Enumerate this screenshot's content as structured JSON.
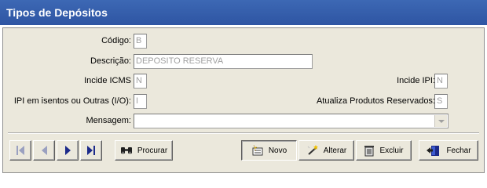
{
  "window": {
    "title": "Tipos de Depósitos"
  },
  "form": {
    "codigo": {
      "label": "Código:",
      "value": "B"
    },
    "descricao": {
      "label": "Descrição:",
      "value": "DEPOSITO RESERVA"
    },
    "incide_icms": {
      "label": "Incide ICMS",
      "value": "N"
    },
    "incide_ipi": {
      "label": "Incide IPI:",
      "value": "N"
    },
    "ipi_isentos": {
      "label": "IPI em isentos ou Outras (I/O):",
      "value": "I"
    },
    "atualiza": {
      "label": "Atualiza Produtos Reservados:",
      "value": "S"
    },
    "mensagem": {
      "label": "Mensagem:",
      "value": ""
    }
  },
  "toolbar": {
    "procurar": "Procurar",
    "novo": "Novo",
    "alterar": "Alterar",
    "excluir": "Excluir",
    "fechar": "Fechar"
  },
  "colors": {
    "title_bar": "#2e55a3",
    "panel": "#ebe8dc"
  },
  "icons": [
    "first-record-icon",
    "prev-record-icon",
    "next-record-icon",
    "last-record-icon",
    "binoculars-icon",
    "new-record-icon",
    "edit-wand-icon",
    "trash-icon",
    "exit-door-icon",
    "dropdown-arrow-icon"
  ]
}
